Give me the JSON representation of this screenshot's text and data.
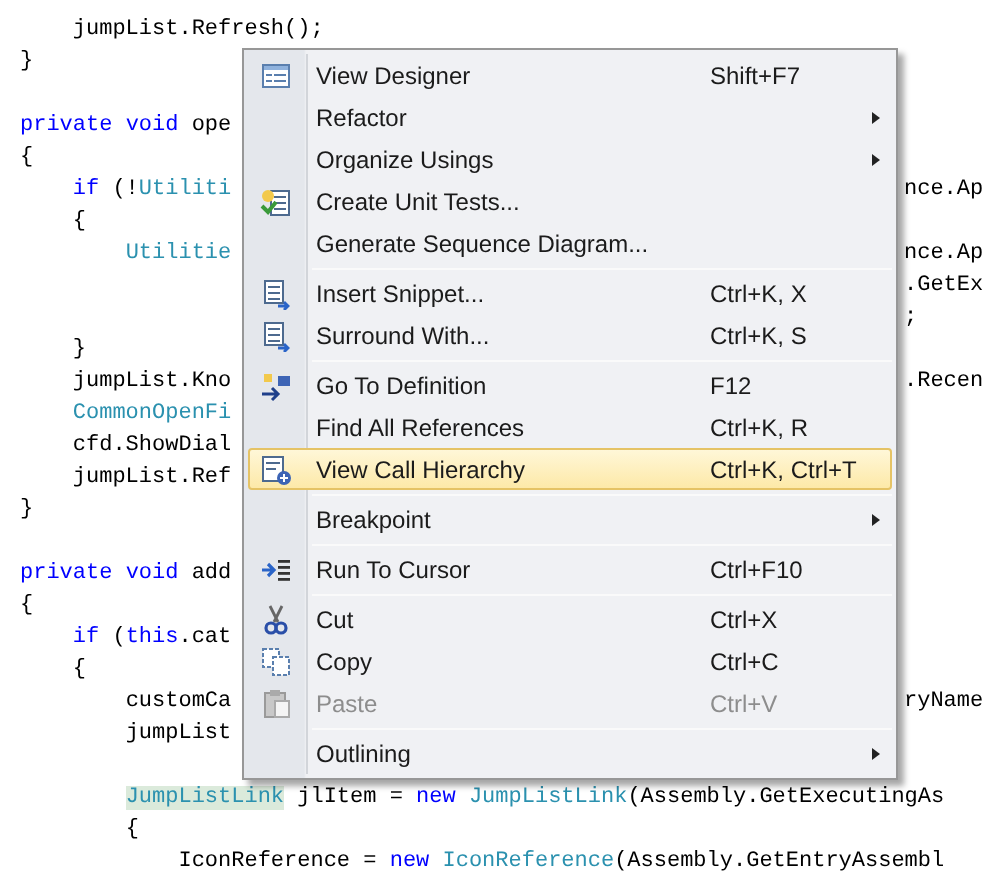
{
  "code_lines": [
    {
      "kind": "code",
      "tokens": [
        {
          "text": "    jumpList.Refresh();",
          "kind": "plain"
        }
      ]
    },
    {
      "kind": "code",
      "tokens": [
        {
          "text": "}",
          "kind": "plain"
        }
      ]
    },
    {
      "kind": "blank"
    },
    {
      "kind": "code",
      "tokens": [
        {
          "text": "private",
          "kind": "keyword"
        },
        {
          "text": " void",
          "kind": "keyword"
        },
        {
          "text": " ope",
          "kind": "plain"
        }
      ]
    },
    {
      "kind": "code",
      "tokens": [
        {
          "text": "{",
          "kind": "plain"
        }
      ]
    },
    {
      "kind": "code",
      "tokens": [
        {
          "text": "    if",
          "kind": "keyword"
        },
        {
          "text": " (!",
          "kind": "plain"
        },
        {
          "text": "Utiliti",
          "kind": "type"
        }
      ],
      "right": "nce.Ap"
    },
    {
      "kind": "code",
      "tokens": [
        {
          "text": "    {",
          "kind": "plain"
        }
      ]
    },
    {
      "kind": "code",
      "tokens": [
        {
          "text": "        Utilitie",
          "kind": "type"
        }
      ],
      "right": "nce.Ap"
    },
    {
      "kind": "code",
      "right": ".GetEx"
    },
    {
      "kind": "code",
      "right": ";"
    },
    {
      "kind": "code",
      "tokens": [
        {
          "text": "    }",
          "kind": "plain"
        }
      ]
    },
    {
      "kind": "code",
      "tokens": [
        {
          "text": "    jumpList.Kno",
          "kind": "plain"
        }
      ],
      "right": ".Recen"
    },
    {
      "kind": "code",
      "tokens": [
        {
          "text": "    CommonOpenFi",
          "kind": "type"
        }
      ]
    },
    {
      "kind": "code",
      "tokens": [
        {
          "text": "    cfd.ShowDial",
          "kind": "plain"
        }
      ]
    },
    {
      "kind": "code",
      "tokens": [
        {
          "text": "    jumpList.Ref",
          "kind": "plain"
        }
      ]
    },
    {
      "kind": "code",
      "tokens": [
        {
          "text": "}",
          "kind": "plain"
        }
      ]
    },
    {
      "kind": "blank"
    },
    {
      "kind": "code",
      "tokens": [
        {
          "text": "private",
          "kind": "keyword"
        },
        {
          "text": " void",
          "kind": "keyword"
        },
        {
          "text": " add",
          "kind": "plain"
        }
      ]
    },
    {
      "kind": "code",
      "tokens": [
        {
          "text": "{",
          "kind": "plain"
        }
      ]
    },
    {
      "kind": "code",
      "tokens": [
        {
          "text": "    if",
          "kind": "keyword"
        },
        {
          "text": " (",
          "kind": "plain"
        },
        {
          "text": "this",
          "kind": "keyword"
        },
        {
          "text": ".cat",
          "kind": "plain"
        }
      ]
    },
    {
      "kind": "code",
      "tokens": [
        {
          "text": "    {",
          "kind": "plain"
        }
      ]
    },
    {
      "kind": "code",
      "tokens": [
        {
          "text": "        customCa",
          "kind": "plain"
        }
      ],
      "right": "ryName"
    },
    {
      "kind": "code",
      "tokens": [
        {
          "text": "        jumpList",
          "kind": "plain"
        }
      ]
    },
    {
      "kind": "blank"
    },
    {
      "kind": "code",
      "tokens": [
        {
          "text": "        JumpListLink",
          "kind": "highlighted-type"
        },
        {
          "text": " jlItem = ",
          "kind": "plain"
        },
        {
          "text": "new",
          "kind": "keyword"
        },
        {
          "text": " JumpListLink",
          "kind": "type"
        },
        {
          "text": "(Assembly.GetExecutingAs",
          "kind": "plain"
        }
      ]
    },
    {
      "kind": "code",
      "tokens": [
        {
          "text": "        {",
          "kind": "plain"
        }
      ]
    },
    {
      "kind": "code",
      "tokens": [
        {
          "text": "            IconReference = ",
          "kind": "plain"
        },
        {
          "text": "new",
          "kind": "keyword"
        },
        {
          "text": " IconReference",
          "kind": "type"
        },
        {
          "text": "(Assembly.GetEntryAssembl",
          "kind": "plain"
        }
      ]
    }
  ],
  "context_menu": {
    "items": [
      {
        "kind": "item",
        "label": "View Designer",
        "shortcut": "Shift+F7",
        "submenu": false,
        "selected": false,
        "disabled": false
      },
      {
        "kind": "item",
        "label": "Refactor",
        "submenu": true,
        "selected": false,
        "disabled": false
      },
      {
        "kind": "item",
        "label": "Organize Usings",
        "submenu": true,
        "selected": false,
        "disabled": false
      },
      {
        "kind": "item",
        "label": "Create Unit Tests...",
        "submenu": false,
        "selected": false,
        "disabled": false
      },
      {
        "kind": "item",
        "label": "Generate Sequence Diagram...",
        "submenu": false,
        "selected": false,
        "disabled": false
      },
      {
        "kind": "separator"
      },
      {
        "kind": "item",
        "label": "Insert Snippet...",
        "shortcut": "Ctrl+K, X",
        "submenu": false,
        "selected": false,
        "disabled": false
      },
      {
        "kind": "item",
        "label": "Surround With...",
        "shortcut": "Ctrl+K, S",
        "submenu": false,
        "selected": false,
        "disabled": false
      },
      {
        "kind": "separator"
      },
      {
        "kind": "item",
        "label": "Go To Definition",
        "shortcut": "F12",
        "submenu": false,
        "selected": false,
        "disabled": false
      },
      {
        "kind": "item",
        "label": "Find All References",
        "shortcut": "Ctrl+K, R",
        "submenu": false,
        "selected": false,
        "disabled": false
      },
      {
        "kind": "item",
        "label": "View Call Hierarchy",
        "shortcut": "Ctrl+K, Ctrl+T",
        "submenu": false,
        "selected": true,
        "disabled": false
      },
      {
        "kind": "separator"
      },
      {
        "kind": "item",
        "label": "Breakpoint",
        "submenu": true,
        "selected": false,
        "disabled": false
      },
      {
        "kind": "separator"
      },
      {
        "kind": "item",
        "label": "Run To Cursor",
        "shortcut": "Ctrl+F10",
        "submenu": false,
        "selected": false,
        "disabled": false
      },
      {
        "kind": "separator"
      },
      {
        "kind": "item",
        "label": "Cut",
        "shortcut": "Ctrl+X",
        "submenu": false,
        "selected": false,
        "disabled": false
      },
      {
        "kind": "item",
        "label": "Copy",
        "shortcut": "Ctrl+C",
        "submenu": false,
        "selected": false,
        "disabled": false
      },
      {
        "kind": "item",
        "label": "Paste",
        "shortcut": "Ctrl+V",
        "submenu": false,
        "selected": false,
        "disabled": true
      },
      {
        "kind": "separator"
      },
      {
        "kind": "item",
        "label": "Outlining",
        "submenu": true,
        "selected": false,
        "disabled": false
      }
    ]
  }
}
